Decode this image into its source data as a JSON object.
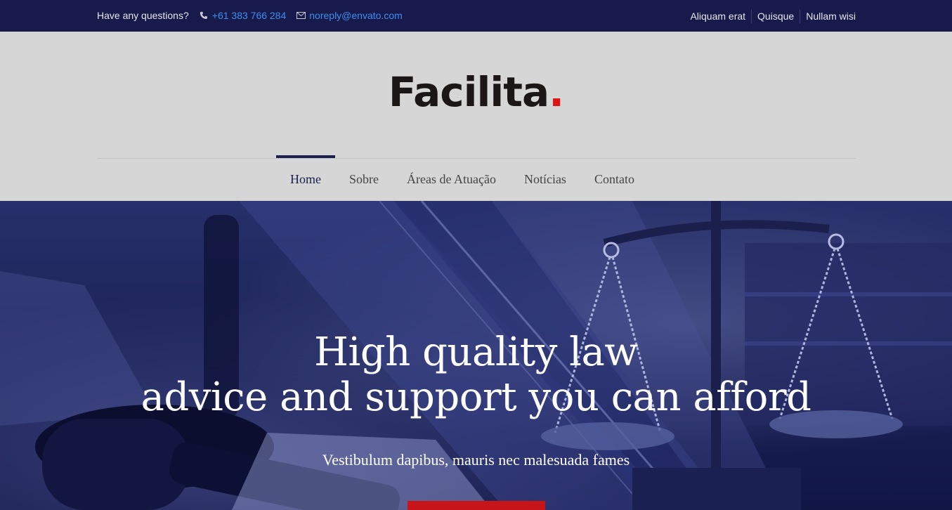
{
  "topbar": {
    "question": "Have any questions?",
    "phone": "+61 383 766 284",
    "email": "noreply@envato.com",
    "links": [
      "Aliquam erat",
      "Quisque",
      "Nullam wisi"
    ]
  },
  "logo": {
    "text": "Facilita",
    "dot": "."
  },
  "nav": {
    "items": [
      {
        "label": "Home",
        "active": true
      },
      {
        "label": "Sobre"
      },
      {
        "label": "Áreas de Atuação"
      },
      {
        "label": "Notícias"
      },
      {
        "label": "Contato"
      }
    ]
  },
  "hero": {
    "title_line1": "High quality law",
    "title_line2": "advice and support you can afford",
    "subtitle": "Vestibulum dapibus, mauris nec malesuada fames"
  },
  "colors": {
    "topbar_bg": "#171a4a",
    "accent_link": "#3c8ef0",
    "nav_active": "#1c1f4f",
    "brand_red": "#e01414",
    "button_red": "#c8151b"
  }
}
